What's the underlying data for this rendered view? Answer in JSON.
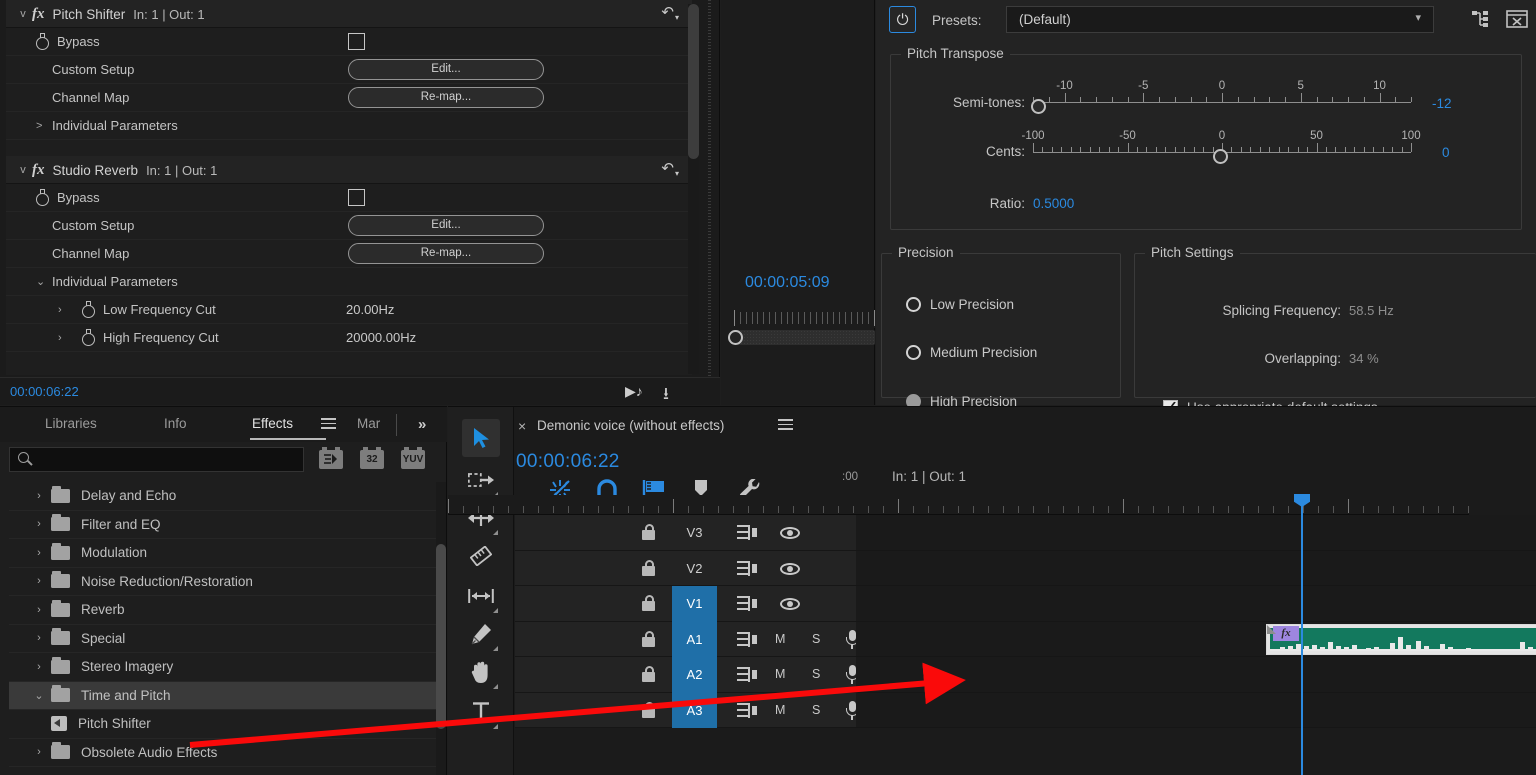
{
  "effect_controls": {
    "effects": [
      {
        "name": "Pitch Shifter",
        "io": "In: 1 | Out: 1",
        "expanded_chevron": "v",
        "rows": [
          {
            "label": "Bypass",
            "type": "checkbox",
            "value": ""
          },
          {
            "label": "Custom Setup",
            "type": "button",
            "value": "Edit..."
          },
          {
            "label": "Channel Map",
            "type": "button",
            "value": "Re-map..."
          },
          {
            "label": "Individual Parameters",
            "type": "group",
            "value": "",
            "chevron": ">"
          }
        ]
      },
      {
        "name": "Studio Reverb",
        "io": "In: 1 | Out: 1",
        "expanded_chevron": "v",
        "rows": [
          {
            "label": "Bypass",
            "type": "checkbox",
            "value": ""
          },
          {
            "label": "Custom Setup",
            "type": "button",
            "value": "Edit..."
          },
          {
            "label": "Channel Map",
            "type": "button",
            "value": "Re-map..."
          },
          {
            "label": "Individual Parameters",
            "type": "group",
            "value": "",
            "chevron": "v"
          },
          {
            "label": "Low Frequency Cut",
            "type": "param",
            "value": "20.00Hz",
            "chevron": ">"
          },
          {
            "label": "High Frequency Cut",
            "type": "param",
            "value": "20000.00Hz",
            "chevron": ">"
          }
        ]
      }
    ],
    "footer_timecode": "00:00:06:22"
  },
  "program_monitor": {
    "timecode": "00:00:05:09"
  },
  "plugin": {
    "presets_label": "Presets:",
    "presets_value": "(Default)",
    "pitch_transpose": {
      "legend": "Pitch Transpose",
      "semitones_label": "Semi-tones:",
      "semitones_value": "-12",
      "semitones_ticks": [
        "-10",
        "-5",
        "0",
        "5",
        "10"
      ],
      "semitones_min": -12,
      "semitones_max": 12,
      "cents_label": "Cents:",
      "cents_value": "0",
      "cents_ticks": [
        "-100",
        "-50",
        "0",
        "50",
        "100"
      ],
      "cents_min": -100,
      "cents_max": 100,
      "ratio_label": "Ratio:",
      "ratio_value": "0.5000"
    },
    "precision": {
      "legend": "Precision",
      "options": [
        {
          "label": "Low Precision",
          "selected": false
        },
        {
          "label": "Medium Precision",
          "selected": false
        },
        {
          "label": "High Precision",
          "selected": true
        }
      ]
    },
    "pitch_settings": {
      "legend": "Pitch Settings",
      "splicing_label": "Splicing Frequency:",
      "splicing_value": "58.5 Hz",
      "overlapping_label": "Overlapping:",
      "overlapping_value": "34 %",
      "default_checkbox_label": "Use appropriate default settings",
      "default_checked": true
    }
  },
  "effects_browser": {
    "tabs": [
      {
        "label": "Libraries",
        "active": false
      },
      {
        "label": "Info",
        "active": false
      },
      {
        "label": "Effects",
        "active": true
      },
      {
        "label": "Mar",
        "active": false
      }
    ],
    "overflow_label": "»",
    "search_placeholder": "",
    "search_value": "",
    "filter_badges": [
      "",
      "32",
      "YUV"
    ],
    "items": [
      {
        "label": "Delay and Echo",
        "type": "folder",
        "expanded": false,
        "selected": false
      },
      {
        "label": "Filter and EQ",
        "type": "folder",
        "expanded": false,
        "selected": false
      },
      {
        "label": "Modulation",
        "type": "folder",
        "expanded": false,
        "selected": false
      },
      {
        "label": "Noise Reduction/Restoration",
        "type": "folder",
        "expanded": false,
        "selected": false
      },
      {
        "label": "Reverb",
        "type": "folder",
        "expanded": false,
        "selected": false
      },
      {
        "label": "Special",
        "type": "folder",
        "expanded": false,
        "selected": false
      },
      {
        "label": "Stereo Imagery",
        "type": "folder",
        "expanded": false,
        "selected": false
      },
      {
        "label": "Time and Pitch",
        "type": "folder",
        "expanded": true,
        "selected": true
      },
      {
        "label": "Pitch Shifter",
        "type": "effect",
        "expanded": false,
        "selected": false
      },
      {
        "label": "Obsolete Audio Effects",
        "type": "folder",
        "expanded": false,
        "selected": false
      }
    ]
  },
  "timeline": {
    "close_label": "×",
    "sequence_name": "Demonic voice (without effects)",
    "timecode": "00:00:06:22",
    "ruler_label": ":00",
    "in_out": "In: 1 | Out: 1",
    "tracks": [
      {
        "name": "V3",
        "kind": "video",
        "targeted": false,
        "mute": "",
        "solo": ""
      },
      {
        "name": "V2",
        "kind": "video",
        "targeted": false,
        "mute": "",
        "solo": ""
      },
      {
        "name": "V1",
        "kind": "video",
        "targeted": true,
        "mute": "",
        "solo": ""
      },
      {
        "name": "A1",
        "kind": "audio",
        "targeted": true,
        "mute": "M",
        "solo": "S"
      },
      {
        "name": "A2",
        "kind": "audio",
        "targeted": true,
        "mute": "M",
        "solo": "S"
      },
      {
        "name": "A3",
        "kind": "audio",
        "targeted": true,
        "mute": "M",
        "solo": "S"
      }
    ],
    "clip": {
      "fx_badge": "fx",
      "track": "A1",
      "color": "#13795e"
    },
    "tools": [
      "selection-tool",
      "track-select-forward-tool",
      "ripple-edit-tool",
      "rate-stretch-tool",
      "slip-tool",
      "pen-tool",
      "hand-tool",
      "type-tool"
    ]
  },
  "annotation": {
    "arrow_color": "#fa0a0a",
    "from": "Pitch Shifter",
    "to": "audio clip on A1"
  },
  "colors": {
    "accent_blue": "#2b8ae0",
    "track_target": "#1f6fa8",
    "clip_green": "#13795e",
    "panel_bg": "#1e1e1e"
  }
}
